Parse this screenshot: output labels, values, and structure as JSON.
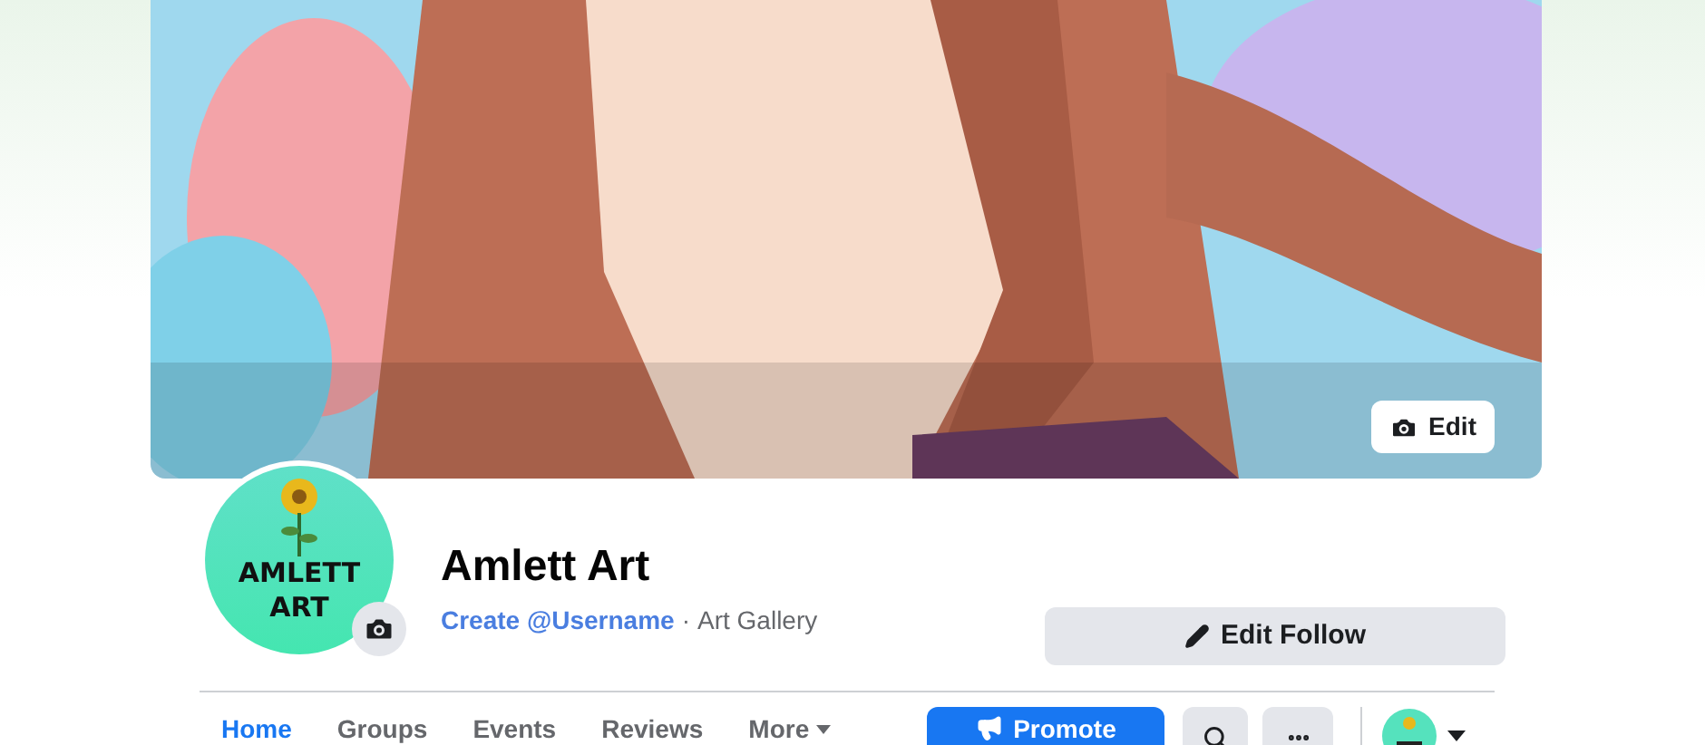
{
  "cover": {
    "kind": "picture",
    "edit_button": "Edit"
  },
  "profile": {
    "avatar_lines": [
      "AMLETT",
      "ART"
    ],
    "name": "Amlett Art",
    "username_link": "Create @Username",
    "separator": "·",
    "category": "Art Gallery"
  },
  "edit_follow_button": "Edit Follow",
  "tabs": [
    {
      "label": "Home",
      "selected": true
    },
    {
      "label": "Groups",
      "selected": false
    },
    {
      "label": "Events",
      "selected": false
    },
    {
      "label": "Reviews",
      "selected": false
    },
    {
      "label": "More",
      "selected": false,
      "kind": "dropdown"
    }
  ],
  "actions": {
    "promote": "Promote"
  }
}
